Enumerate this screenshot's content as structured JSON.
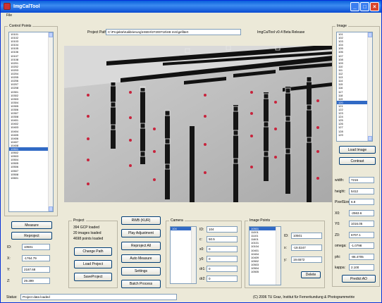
{
  "window": {
    "title": "ImgCalTool",
    "menu": "File"
  },
  "project_path": {
    "label": "Project Path:",
    "value": "C:\\Projekte\\Kalibrierung\\HSEH\\07200718\\H8 mm\\gefiltert"
  },
  "version": "ImgCalTool v0.4 Beta Release",
  "control_points": {
    "title": "Control Points",
    "items": [
      "10101",
      "10102",
      "10103",
      "10104",
      "10105",
      "10106",
      "10107",
      "10108",
      "10201",
      "10202",
      "10203",
      "10204",
      "10205",
      "10206",
      "10207",
      "10208",
      "10301",
      "10302",
      "10303",
      "10304",
      "10305",
      "10306",
      "10307",
      "10308",
      "10401",
      "10402",
      "10403",
      "10404",
      "10405",
      "10406",
      "10407",
      "10408",
      "10501",
      "10502",
      "10503",
      "10504",
      "10505",
      "10506",
      "10507",
      "10508",
      "10601"
    ],
    "selected": "10501"
  },
  "measure_btn": "Measure",
  "reproject_btn": "Reproject",
  "point_fields": [
    {
      "label": "ID:",
      "value": "10501"
    },
    {
      "label": "X:",
      "value": "-1764.79"
    },
    {
      "label": "Y:",
      "value": "2187.68"
    },
    {
      "label": "Z:",
      "value": "29.399"
    }
  ],
  "image_list": {
    "title": "Image",
    "items": [
      "101",
      "102",
      "103",
      "104",
      "105",
      "106",
      "107",
      "108",
      "109",
      "110",
      "111",
      "112",
      "113",
      "114",
      "115",
      "116",
      "117",
      "118",
      "119",
      "120",
      "121",
      "122",
      "123",
      "124",
      "125",
      "126",
      "127",
      "128",
      "129"
    ],
    "selected": "120"
  },
  "load_image_btn": "Load Image",
  "contrast_btn": "Contrast",
  "params": [
    {
      "label": "width:",
      "value": "7216"
    },
    {
      "label": "height:",
      "value": "5412"
    },
    {
      "label": "PixelSize:",
      "value": "6.8"
    },
    {
      "label": "X0:",
      "value": "-2563.6"
    },
    {
      "label": "Y0:",
      "value": "1016.05"
    },
    {
      "label": "Z0:",
      "value": "6707.1"
    },
    {
      "label": "omega:",
      "value": "-1.0798"
    },
    {
      "label": "phi:",
      "value": "-86.4705"
    },
    {
      "label": "kappa:",
      "value": "2.100"
    }
  ],
  "predict_btn": "Predict AO",
  "project": {
    "title": "Project",
    "lines": [
      "394 GCP loaded",
      "20 images loaded",
      "4698 points loaded"
    ],
    "buttons": [
      "Change Path",
      "Load Project",
      "SaveProject"
    ]
  },
  "actions": [
    "RWB (KUR)",
    "Play Adjustment",
    "Reproject All",
    "Auto Measure",
    "Settings",
    "Batch Process"
  ],
  "camera": {
    "title": "Camera",
    "list": [
      "104"
    ],
    "selected": "104",
    "fields": [
      {
        "label": "ID:",
        "value": "104"
      },
      {
        "label": "c:",
        "value": "50.5"
      },
      {
        "label": "x0:",
        "value": "0"
      },
      {
        "label": "y0:",
        "value": "0"
      },
      {
        "label": "dr1:",
        "value": "0"
      },
      {
        "label": "dr2:",
        "value": "0"
      }
    ]
  },
  "image_points": {
    "title": "Image Points",
    "items": [
      "10501",
      "11001",
      "11101",
      "11601",
      "10101",
      "10104",
      "10401",
      "10404",
      "10409",
      "10502",
      "10503",
      "10504",
      "10505"
    ],
    "selected": "10501",
    "fields": [
      {
        "label": "ID:",
        "value": "10501"
      },
      {
        "label": "x:",
        "value": "-19.0247"
      },
      {
        "label": "y:",
        "value": "19.6572"
      }
    ],
    "delete_btn": "Delete"
  },
  "status": {
    "label": "Status:",
    "value": "Project data loaded",
    "copyright": "(C) 2006 TU Graz, Institut für Fernerkundung & Photogrammetrie"
  },
  "colors": {
    "titlebar": "#0a4bd1",
    "selection": "#316ac5",
    "window_bg": "#ece9d8"
  }
}
